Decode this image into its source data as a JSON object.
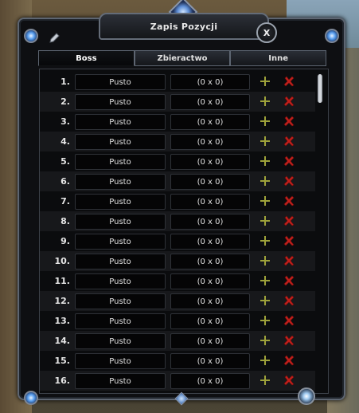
{
  "window": {
    "title": "Zapis Pozycji",
    "close_label": "X"
  },
  "tabs": [
    {
      "label": "Boss",
      "active": true
    },
    {
      "label": "Zbieractwo",
      "active": false
    },
    {
      "label": "Inne",
      "active": false
    }
  ],
  "colors": {
    "add_icon": "#9ea23a",
    "delete_icon": "#c0201c",
    "panel_bg": "#0b0c0e",
    "row_alt_bg": "#17181b"
  },
  "rows": [
    {
      "index": "1.",
      "name": "Pusto",
      "coords": "(0 x 0)"
    },
    {
      "index": "2.",
      "name": "Pusto",
      "coords": "(0 x 0)"
    },
    {
      "index": "3.",
      "name": "Pusto",
      "coords": "(0 x 0)"
    },
    {
      "index": "4.",
      "name": "Pusto",
      "coords": "(0 x 0)"
    },
    {
      "index": "5.",
      "name": "Pusto",
      "coords": "(0 x 0)"
    },
    {
      "index": "6.",
      "name": "Pusto",
      "coords": "(0 x 0)"
    },
    {
      "index": "7.",
      "name": "Pusto",
      "coords": "(0 x 0)"
    },
    {
      "index": "8.",
      "name": "Pusto",
      "coords": "(0 x 0)"
    },
    {
      "index": "9.",
      "name": "Pusto",
      "coords": "(0 x 0)"
    },
    {
      "index": "10.",
      "name": "Pusto",
      "coords": "(0 x 0)"
    },
    {
      "index": "11.",
      "name": "Pusto",
      "coords": "(0 x 0)"
    },
    {
      "index": "12.",
      "name": "Pusto",
      "coords": "(0 x 0)"
    },
    {
      "index": "13.",
      "name": "Pusto",
      "coords": "(0 x 0)"
    },
    {
      "index": "14.",
      "name": "Pusto",
      "coords": "(0 x 0)"
    },
    {
      "index": "15.",
      "name": "Pusto",
      "coords": "(0 x 0)"
    },
    {
      "index": "16.",
      "name": "Pusto",
      "coords": "(0 x 0)"
    }
  ],
  "icons": {
    "add": "plus-icon",
    "delete": "cross-icon",
    "edit": "pencil-icon"
  }
}
